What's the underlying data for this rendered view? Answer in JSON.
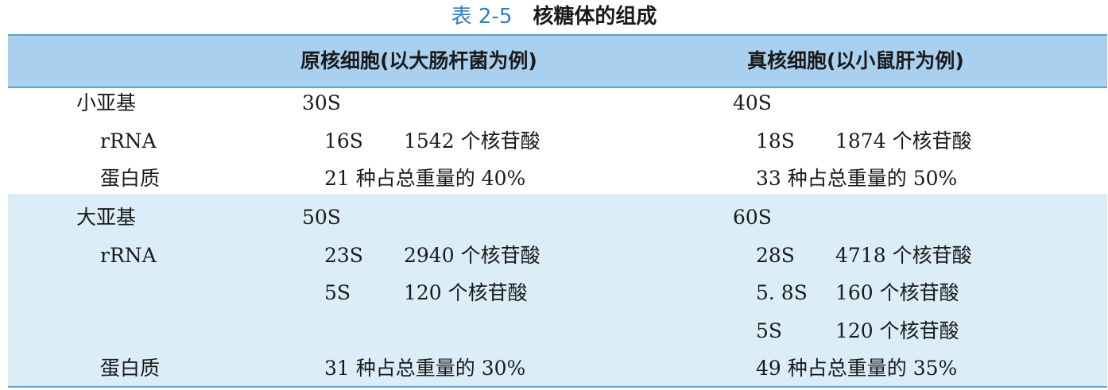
{
  "caption": {
    "number": "表 2-5",
    "title": "核糖体的组成"
  },
  "header": {
    "col1": "原核细胞(以大肠杆菌为例)",
    "col2": "真核细胞(以小鼠肝为例)"
  },
  "rows": [
    {
      "label": "小亚基",
      "p_a": "30S",
      "p_b": "",
      "e_a": "40S",
      "e_b": ""
    },
    {
      "label": "rRNA",
      "p_a": "16S",
      "p_b": "1542 个核苷酸",
      "e_a": "18S",
      "e_b": "1874 个核苷酸"
    },
    {
      "label": "蛋白质",
      "p_a": "21 种占总重量的 40%",
      "p_b": "",
      "e_a": "33 种占总重量的 50%",
      "e_b": ""
    },
    {
      "label": "大亚基",
      "p_a": "50S",
      "p_b": "",
      "e_a": "60S",
      "e_b": ""
    },
    {
      "label": "rRNA",
      "p_a": "23S",
      "p_b": "2940 个核苷酸",
      "e_a": "28S",
      "e_b": "4718 个核苷酸"
    },
    {
      "label": "",
      "p_a": "5S",
      "p_b": "120 个核苷酸",
      "e_a": "5. 8S",
      "e_b": "160 个核苷酸"
    },
    {
      "label": "",
      "p_a": "",
      "p_b": "",
      "e_a": "5S",
      "e_b": "120 个核苷酸"
    },
    {
      "label": "蛋白质",
      "p_a": "31 种占总重量的 30%",
      "p_b": "",
      "e_a": "49 种占总重量的 35%",
      "e_b": ""
    }
  ]
}
